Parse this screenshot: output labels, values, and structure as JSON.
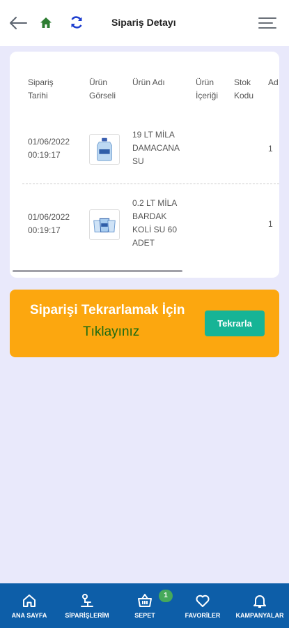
{
  "header": {
    "title": "Sipariş Detayı"
  },
  "table": {
    "headers": [
      {
        "l1": "Sipariş",
        "l2": "Tarihi"
      },
      {
        "l1": "Ürün",
        "l2": "Görseli"
      },
      {
        "l1": "Ürün Adı",
        "l2": ""
      },
      {
        "l1": "Ürün",
        "l2": "İçeriği"
      },
      {
        "l1": "Stok",
        "l2": "Kodu"
      },
      {
        "l1": "Ad",
        "l2": ""
      }
    ],
    "rows": [
      {
        "date": "01/06/2022",
        "time": "00:19:17",
        "name": [
          "19 LT MİLA",
          "DAMACANA",
          "SU"
        ],
        "qty": "1"
      },
      {
        "date": "01/06/2022",
        "time": "00:19:17",
        "name": [
          "0.2 LT MİLA",
          "BARDAK",
          "KOLİ SU 60",
          "ADET"
        ],
        "qty": "1"
      }
    ]
  },
  "banner": {
    "line1": "Siparişi Tekrarlamak İçin",
    "line2": "Tıklayınız",
    "button": "Tekrarla"
  },
  "nav": {
    "items": [
      {
        "label": "ANA SAYFA"
      },
      {
        "label": "SİPARİŞLERİM"
      },
      {
        "label": "SEPET"
      },
      {
        "label": "FAVORİLER"
      },
      {
        "label": "KAMPANYALAR"
      }
    ],
    "cart_badge": "1"
  },
  "colors": {
    "accent": "#0d5ea8",
    "banner": "#fca70f",
    "button": "#16b496",
    "home_icon": "#2e7d32",
    "refresh_icon": "#1e3fcf"
  }
}
